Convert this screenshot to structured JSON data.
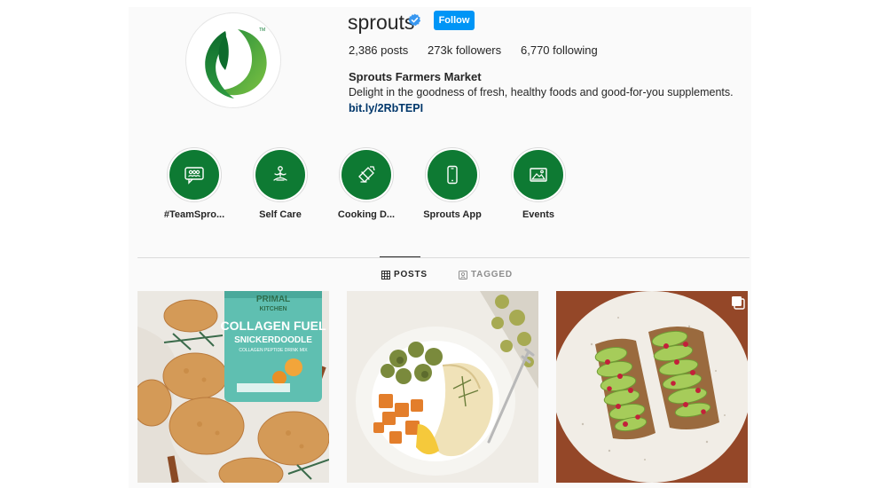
{
  "profile": {
    "username": "sprouts",
    "follow_label": "Follow",
    "stats": {
      "posts": "2,386",
      "posts_label": "posts",
      "followers": "273k",
      "followers_label": "followers",
      "following": "6,770",
      "following_label": "following"
    },
    "full_name": "Sprouts Farmers Market",
    "bio": "Delight in the goodness of fresh, healthy foods and good-for-you supplements.",
    "link": "bit.ly/2RbTEPI",
    "logo_trademark": "TM"
  },
  "highlights": [
    {
      "label": "#TeamSpro...",
      "icon": "people-chat-icon"
    },
    {
      "label": "Self Care",
      "icon": "meditation-icon"
    },
    {
      "label": "Cooking D...",
      "icon": "knife-cutting-board-icon"
    },
    {
      "label": "Sprouts App",
      "icon": "phone-icon"
    },
    {
      "label": "Events",
      "icon": "picture-icon"
    }
  ],
  "tabs": {
    "posts": "POSTS",
    "tagged": "TAGGED"
  },
  "posts": [
    {
      "icon": "snickerdoodle-cookies-collagen-jar-image",
      "jar_brand_line1": "PRIMAL",
      "jar_brand_line2": "KITCHEN",
      "jar_title": "COLLAGEN FUEL",
      "jar_flavor": "SNICKERDOODLE",
      "jar_sub": "COLLAGEN PEPTIDE DRINK MIX"
    },
    {
      "icon": "chicken-vegetables-plate-image"
    },
    {
      "icon": "avocado-toast-image",
      "badge": "multiple-photos-icon"
    }
  ],
  "colors": {
    "brand_green": "#0e7a33",
    "follow_blue": "#0095f6",
    "link_blue": "#00376b",
    "verified_blue": "#3897f0"
  }
}
